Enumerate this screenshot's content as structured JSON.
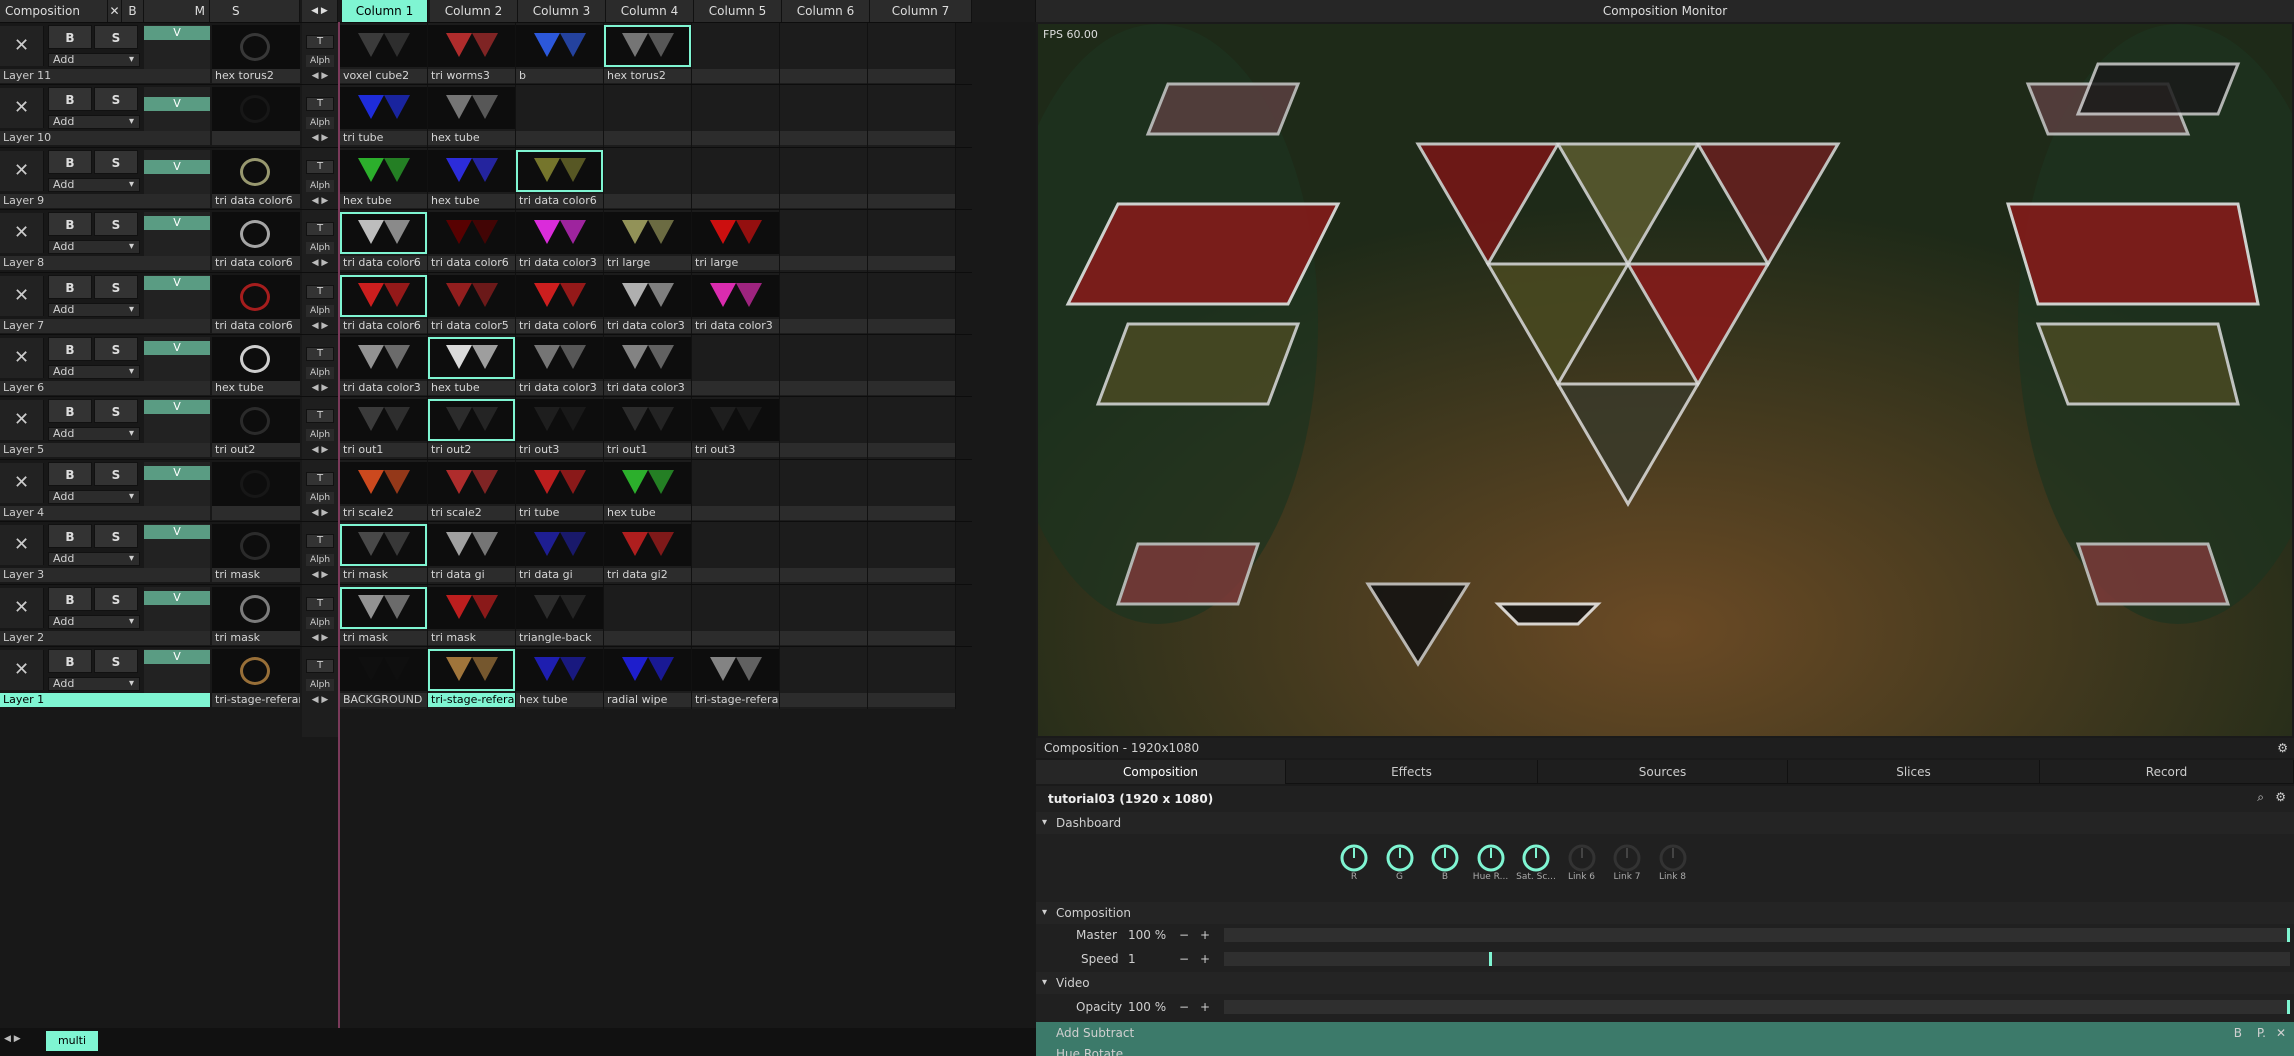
{
  "topbar": {
    "comp_label": "Composition",
    "x": "✕",
    "b": "B",
    "m": "M",
    "s": "S",
    "nav": "◀ ▶"
  },
  "columns": [
    "Column 1",
    "Column 2",
    "Column 3",
    "Column 4",
    "Column 5",
    "Column 6",
    "Column 7"
  ],
  "layers": [
    {
      "name": "Layer 11",
      "v": "V",
      "preview": "hex torus2",
      "clips": [
        "voxel cube2",
        "tri worms3",
        "b",
        "hex torus2",
        "",
        "",
        ""
      ]
    },
    {
      "name": "Layer 10",
      "v": "V",
      "preview": "",
      "clips": [
        "tri tube",
        "hex tube",
        "",
        "",
        "",
        "",
        ""
      ]
    },
    {
      "name": "Layer 9",
      "v": "V",
      "preview": "tri data color6",
      "clips": [
        "hex tube",
        "hex tube",
        "tri data color6",
        "",
        "",
        "",
        ""
      ]
    },
    {
      "name": "Layer 8",
      "v": "V",
      "preview": "tri data color6",
      "clips": [
        "tri data color6",
        "tri data color6",
        "tri data color3",
        "tri large",
        "tri large",
        "",
        ""
      ]
    },
    {
      "name": "Layer 7",
      "v": "V",
      "preview": "tri data color6",
      "clips": [
        "tri data color6",
        "tri data color5",
        "tri data color6",
        "tri data color3",
        "tri data color3",
        "",
        ""
      ]
    },
    {
      "name": "Layer 6",
      "v": "V",
      "preview": "hex tube",
      "clips": [
        "tri data color3",
        "hex tube",
        "tri data color3",
        "tri data color3",
        "",
        "",
        ""
      ]
    },
    {
      "name": "Layer 5",
      "v": "V",
      "preview": "tri out2",
      "clips": [
        "tri out1",
        "tri out2",
        "tri out3",
        "tri out1",
        "tri out3",
        "",
        ""
      ]
    },
    {
      "name": "Layer 4",
      "v": "V",
      "preview": "",
      "clips": [
        "tri scale2",
        "tri scale2",
        "tri tube",
        "hex tube",
        "",
        "",
        ""
      ]
    },
    {
      "name": "Layer 3",
      "v": "V",
      "preview": "tri mask",
      "clips": [
        "tri mask",
        "tri data gi",
        "tri data gi",
        "tri data gi2",
        "",
        "",
        ""
      ]
    },
    {
      "name": "Layer 2",
      "v": "V",
      "preview": "tri mask",
      "clips": [
        "tri mask",
        "tri mask",
        "triangle-back",
        "",
        "",
        "",
        ""
      ]
    },
    {
      "name": "Layer 1",
      "v": "V",
      "preview": "tri-stage-referance",
      "clips": [
        "BACKGROUND",
        "tri-stage-referance",
        "hex tube",
        "radial wipe",
        "tri-stage-referance",
        "",
        ""
      ]
    }
  ],
  "layer_ctrl": {
    "b": "B",
    "s": "S",
    "add": "Add",
    "t": "T",
    "alph": "Alph",
    "close": "✕",
    "nav": "◀ ▶"
  },
  "deck": {
    "name": "multi",
    "nav": "◀ ▶"
  },
  "monitor": {
    "title": "Composition Monitor",
    "fps": "FPS 60.00",
    "info": "Composition - 1920x1080"
  },
  "tabs": [
    "Composition",
    "Effects",
    "Sources",
    "Slices",
    "Record"
  ],
  "comp": {
    "title": "tutorial03 (1920 x 1080)"
  },
  "dashboard": {
    "label": "Dashboard",
    "knobs": [
      "R",
      "G",
      "B",
      "Hue R...",
      "Sat. Sc...",
      "Link 6",
      "Link 7",
      "Link 8"
    ]
  },
  "composition": {
    "label": "Composition",
    "master_label": "Master",
    "master_val": "100 %",
    "speed_label": "Speed",
    "speed_val": "1",
    "minus": "−",
    "plus": "+"
  },
  "video": {
    "label": "Video",
    "opacity_label": "Opacity",
    "opacity_val": "100 %"
  },
  "effects": {
    "add_subtract": "Add Subtract",
    "hue_rotate": "Hue Rotate",
    "b": "B",
    "p": "P.",
    "x": "✕"
  }
}
